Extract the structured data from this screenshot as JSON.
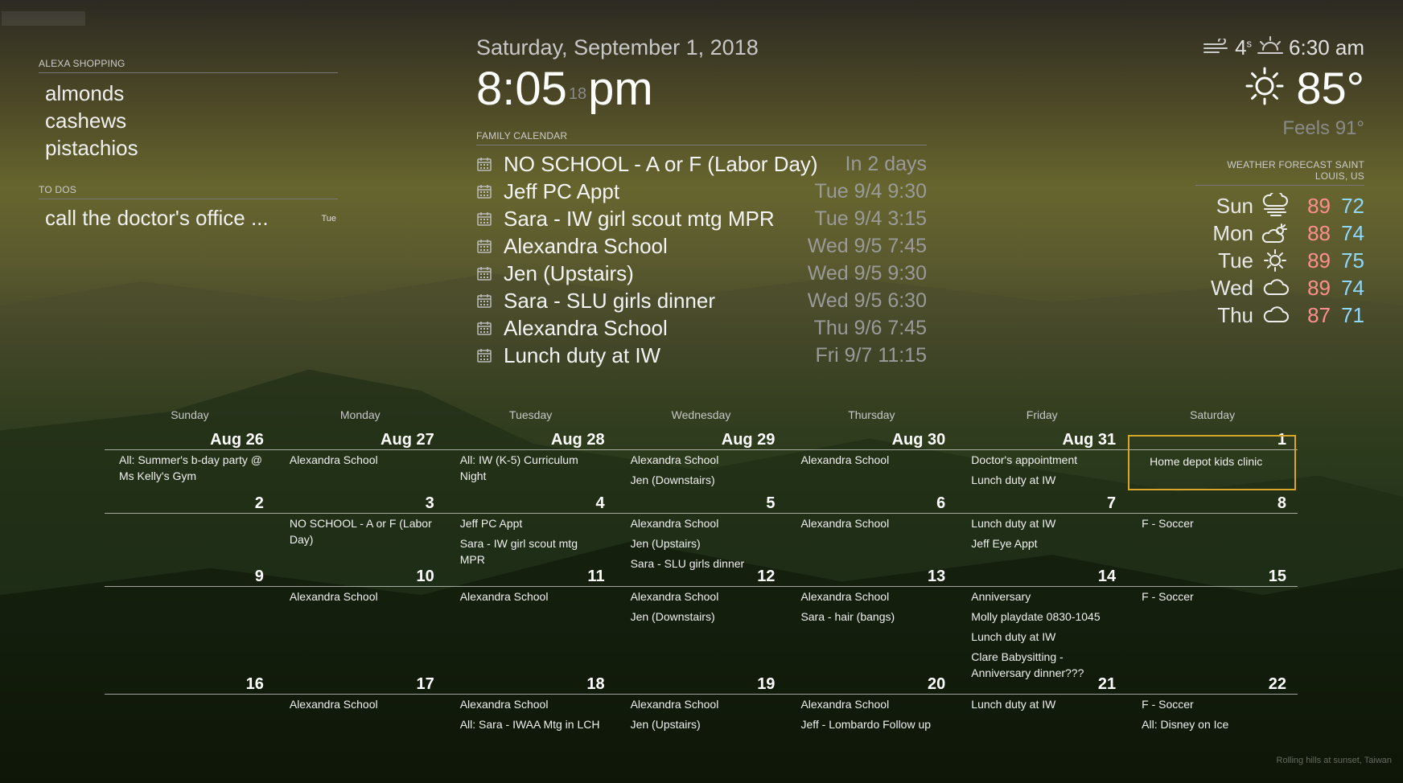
{
  "top_left_label": "",
  "shopping": {
    "header": "ALEXA SHOPPING",
    "items": [
      "almonds",
      "cashews",
      "pistachios"
    ]
  },
  "todos": {
    "header": "TO DOS",
    "items": [
      {
        "text": "call the doctor's office ...",
        "day": "Tue"
      }
    ]
  },
  "clock": {
    "date": "Saturday, September 1, 2018",
    "time_hm": "8:05",
    "seconds": "18",
    "ampm": "pm"
  },
  "family_calendar": {
    "header": "FAMILY CALENDAR",
    "icon": "calendar-icon",
    "events": [
      {
        "title": "NO SCHOOL - A or F (Labor Day)",
        "time": "In 2 days"
      },
      {
        "title": "Jeff PC Appt",
        "time": "Tue 9/4 9:30"
      },
      {
        "title": "Sara - IW girl scout mtg MPR",
        "time": "Tue 9/4 3:15"
      },
      {
        "title": "Alexandra School",
        "time": "Wed 9/5 7:45"
      },
      {
        "title": "Jen (Upstairs)",
        "time": "Wed 9/5 9:30"
      },
      {
        "title": "Sara - SLU girls dinner",
        "time": "Wed 9/5 6:30"
      },
      {
        "title": "Alexandra School",
        "time": "Thu 9/6 7:45"
      },
      {
        "title": "Lunch duty at IW",
        "time": "Fri 9/7 11:15"
      }
    ]
  },
  "weather": {
    "wind_speed": "4",
    "wind_unit": "s",
    "sunset_time": "6:30 am",
    "current_temp": "85°",
    "feels_like": "Feels 91°",
    "current_icon": "sun-icon",
    "forecast_header": "WEATHER FORECAST SAINT LOUIS, US",
    "forecast": [
      {
        "day": "Sun",
        "icon": "rain-wind-icon",
        "hi": "89",
        "lo": "72"
      },
      {
        "day": "Mon",
        "icon": "partly-cloudy-icon",
        "hi": "88",
        "lo": "74"
      },
      {
        "day": "Tue",
        "icon": "sun-icon",
        "hi": "89",
        "lo": "75"
      },
      {
        "day": "Wed",
        "icon": "cloud-icon",
        "hi": "89",
        "lo": "74"
      },
      {
        "day": "Thu",
        "icon": "cloud-icon",
        "hi": "87",
        "lo": "71"
      }
    ],
    "hi_color": "#ff8f8f",
    "lo_color": "#8fd8ff"
  },
  "month": {
    "days_of_week": [
      "Sunday",
      "Monday",
      "Tuesday",
      "Wednesday",
      "Thursday",
      "Friday",
      "Saturday"
    ],
    "today_color": "#d8a72a",
    "weeks": [
      {
        "days": [
          {
            "num": "Aug 26",
            "events": [
              "All: Summer's b-day party @ Ms Kelly's Gym"
            ]
          },
          {
            "num": "Aug 27",
            "events": [
              "Alexandra School"
            ]
          },
          {
            "num": "Aug 28",
            "events": [
              "All: IW (K-5) Curriculum Night"
            ]
          },
          {
            "num": "Aug 29",
            "events": [
              "Alexandra School",
              "Jen (Downstairs)"
            ]
          },
          {
            "num": "Aug 30",
            "events": [
              "Alexandra School"
            ]
          },
          {
            "num": "Aug 31",
            "events": [
              "Doctor's appointment",
              "Lunch duty at IW"
            ]
          },
          {
            "num": "1",
            "events": [
              "Home depot kids clinic"
            ]
          }
        ]
      },
      {
        "days": [
          {
            "num": "2",
            "events": []
          },
          {
            "num": "3",
            "events": [
              "NO SCHOOL - A or F (Labor Day)"
            ]
          },
          {
            "num": "4",
            "events": [
              "Jeff PC Appt",
              "Sara - IW girl scout mtg MPR"
            ]
          },
          {
            "num": "5",
            "events": [
              "Alexandra School",
              "Jen (Upstairs)",
              "Sara - SLU girls dinner"
            ]
          },
          {
            "num": "6",
            "events": [
              "Alexandra School"
            ]
          },
          {
            "num": "7",
            "events": [
              "Lunch duty at IW",
              "Jeff Eye Appt"
            ]
          },
          {
            "num": "8",
            "events": [
              "F - Soccer"
            ]
          }
        ]
      },
      {
        "days": [
          {
            "num": "9",
            "events": []
          },
          {
            "num": "10",
            "events": [
              "Alexandra School"
            ]
          },
          {
            "num": "11",
            "events": [
              "Alexandra School"
            ]
          },
          {
            "num": "12",
            "events": [
              "Alexandra School",
              "Jen (Downstairs)"
            ]
          },
          {
            "num": "13",
            "events": [
              "Alexandra School",
              "Sara - hair (bangs)"
            ]
          },
          {
            "num": "14",
            "events": [
              "Anniversary",
              "Molly playdate 0830-1045",
              "Lunch duty at IW",
              "Clare Babysitting - Anniversary dinner???"
            ]
          },
          {
            "num": "15",
            "events": [
              "F - Soccer"
            ]
          }
        ]
      },
      {
        "days": [
          {
            "num": "16",
            "events": []
          },
          {
            "num": "17",
            "events": [
              "Alexandra School"
            ]
          },
          {
            "num": "18",
            "events": [
              "Alexandra School",
              "All: Sara - IWAA Mtg in LCH"
            ]
          },
          {
            "num": "19",
            "events": [
              "Alexandra School",
              "Jen (Upstairs)"
            ]
          },
          {
            "num": "20",
            "events": [
              "Alexandra School",
              "Jeff - Lombardo Follow up"
            ]
          },
          {
            "num": "21",
            "events": [
              "Lunch duty at IW"
            ]
          },
          {
            "num": "22",
            "events": [
              "F - Soccer",
              "All: Disney on Ice"
            ]
          }
        ]
      }
    ]
  },
  "background_caption": "Rolling hills at sunset, Taiwan"
}
